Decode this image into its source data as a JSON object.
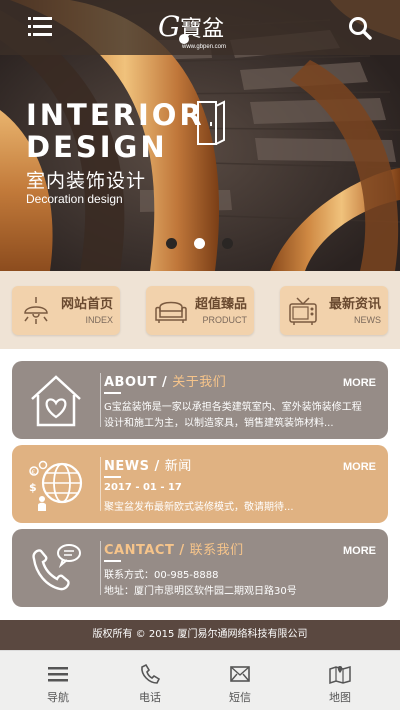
{
  "header": {
    "logo_text": "G寶盆",
    "logo_url": "www.gbpen.com"
  },
  "banner": {
    "title_line1": "INTERIOR",
    "title_line2": "DESIGN",
    "subtitle_cn": "室内装饰设计",
    "subtitle_en": "Decoration design",
    "slides_total": 3,
    "active_slide": 2
  },
  "quick_nav": [
    {
      "cn": "网站首页",
      "en": "INDEX",
      "icon": "lamp-icon"
    },
    {
      "cn": "超值臻品",
      "en": "PRODUCT",
      "icon": "sofa-icon"
    },
    {
      "cn": "最新资讯",
      "en": "NEWS",
      "icon": "tv-icon"
    }
  ],
  "cards": {
    "about": {
      "title_en": "ABOUT / ",
      "title_cn": "关于我们",
      "more": "MORE",
      "line1": "G宝盆装饰是一家以承担各类建筑室内、室外装饰装修工程",
      "line2": "设计和施工为主，以制造家具，销售建筑装饰材料...",
      "icon": "house-heart-icon"
    },
    "news": {
      "title_en": "NEWS / ",
      "title_cn": "新闻",
      "more": "MORE",
      "line1": "2017 - 01 - 17",
      "line2": "聚宝盆发布最新欧式装修模式，敬请期待...",
      "icon": "globe-money-icon"
    },
    "contact": {
      "title_en": "CANTACT / ",
      "title_cn": "联系我们",
      "more": "MORE",
      "line1": "联系方式：00-985-8888",
      "line2": "地址：厦门市思明区软件园二期观日路30号",
      "icon": "phone-chat-icon"
    }
  },
  "copyright": "版权所有 © 2015 厦门易尔通网络科技有限公司",
  "tabbar": [
    {
      "label": "导航",
      "icon": "menu-list-icon"
    },
    {
      "label": "电话",
      "icon": "phone-icon"
    },
    {
      "label": "短信",
      "icon": "mail-icon"
    },
    {
      "label": "地图",
      "icon": "map-icon"
    }
  ],
  "colors": {
    "header_bg": "#3c3028",
    "quick_bg": "#efe3d5",
    "quick_btn": "#f2d2ac",
    "card_gray": "#968c87",
    "card_tan": "#e0b282",
    "accent_title": "#f6c48a",
    "footer_bg": "#5a4840"
  }
}
